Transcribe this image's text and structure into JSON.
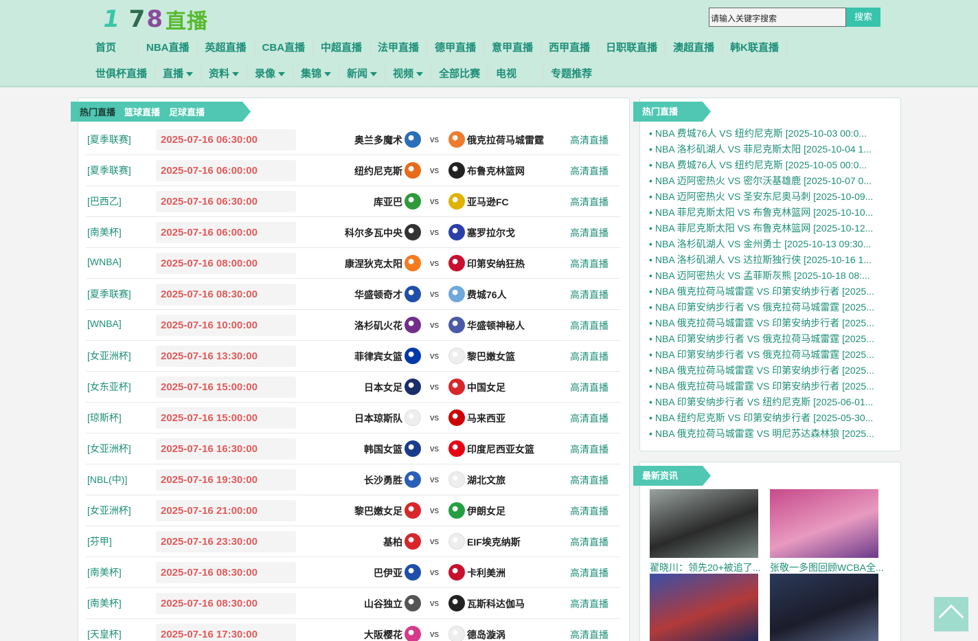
{
  "logo": {
    "p1": "1",
    "p2": "7",
    "p3": "8",
    "p4": "直播"
  },
  "search": {
    "placeholder": "请输入关键字搜索",
    "button": "搜索"
  },
  "nav_row1": [
    "首页",
    "NBA直播",
    "英超直播",
    "CBA直播",
    "中超直播",
    "法甲直播",
    "德甲直播",
    "意甲直播",
    "西甲直播",
    "日职联直播",
    "澳超直播",
    "韩K联直播"
  ],
  "nav_row2": [
    {
      "label": "世俱杯直播",
      "dropdown": false
    },
    {
      "label": "直播",
      "dropdown": true
    },
    {
      "label": "资料",
      "dropdown": true
    },
    {
      "label": "录像",
      "dropdown": true
    },
    {
      "label": "集锦",
      "dropdown": true
    },
    {
      "label": "新闻",
      "dropdown": true
    },
    {
      "label": "视频",
      "dropdown": true
    },
    {
      "label": "全部比赛",
      "dropdown": false
    },
    {
      "label": "电视",
      "dropdown": false
    },
    {
      "label": "专题推荐",
      "dropdown": false
    }
  ],
  "tabs": [
    "热门直播",
    "篮球直播",
    "足球直播"
  ],
  "matches": [
    {
      "league": "[夏季联赛]",
      "time": "2025-07-16 06:30:00",
      "home": "奥兰多魔术",
      "away": "俄克拉荷马城雷霆",
      "home_color": "#2a6fb8",
      "away_color": "#ef7c2e",
      "link": "高清直播"
    },
    {
      "league": "[夏季联赛]",
      "time": "2025-07-16 06:00:00",
      "home": "纽约尼克斯",
      "away": "布鲁克林篮网",
      "home_color": "#e86b1a",
      "away_color": "#222222",
      "link": "高清直播"
    },
    {
      "league": "[巴西乙]",
      "time": "2025-07-16 06:30:00",
      "home": "库亚巴",
      "away": "亚马逊FC",
      "home_color": "#2e9a3a",
      "away_color": "#e0b300",
      "link": "高清直播"
    },
    {
      "league": "[南美杯]",
      "time": "2025-07-16 06:00:00",
      "home": "科尔多瓦中央",
      "away": "塞罗拉尔戈",
      "home_color": "#333333",
      "away_color": "#2a3fa8",
      "link": "高清直播"
    },
    {
      "league": "[WNBA]",
      "time": "2025-07-16 08:00:00",
      "home": "康涅狄克太阳",
      "away": "印第安纳狂热",
      "home_color": "#f47b20",
      "away_color": "#c8102e",
      "link": "高清直播"
    },
    {
      "league": "[夏季联赛]",
      "time": "2025-07-16 08:30:00",
      "home": "华盛顿奇才",
      "away": "费城76人",
      "home_color": "#1f4fa8",
      "away_color": "#6fa8dc",
      "link": "高清直播"
    },
    {
      "league": "[WNBA]",
      "time": "2025-07-16 10:00:00",
      "home": "洛杉矶火花",
      "away": "华盛顿神秘人",
      "home_color": "#702f8a",
      "away_color": "#4a5aa8",
      "link": "高清直播"
    },
    {
      "league": "[女亚洲杯]",
      "time": "2025-07-16 13:30:00",
      "home": "菲律宾女篮",
      "away": "黎巴嫩女篮",
      "home_color": "#0038a8",
      "away_color": "#eeeeee",
      "link": "高清直播"
    },
    {
      "league": "[女东亚杯]",
      "time": "2025-07-16 15:00:00",
      "home": "日本女足",
      "away": "中国女足",
      "home_color": "#1c2d6b",
      "away_color": "#d9262b",
      "link": "高清直播"
    },
    {
      "league": "[琼斯杯]",
      "time": "2025-07-16 15:00:00",
      "home": "日本琼斯队",
      "away": "马来西亚",
      "home_color": "#eeeeee",
      "away_color": "#cc0001",
      "link": "高清直播"
    },
    {
      "league": "[女亚洲杯]",
      "time": "2025-07-16 16:30:00",
      "home": "韩国女篮",
      "away": "印度尼西亚女篮",
      "home_color": "#1a3c8c",
      "away_color": "#e60012",
      "link": "高清直播"
    },
    {
      "league": "[NBL(中)]",
      "time": "2025-07-16 19:30:00",
      "home": "长沙勇胜",
      "away": "湖北文旅",
      "home_color": "#2a5fb8",
      "away_color": "#eeeeee",
      "link": "高清直播"
    },
    {
      "league": "[女亚洲杯]",
      "time": "2025-07-16 21:00:00",
      "home": "黎巴嫩女足",
      "away": "伊朗女足",
      "home_color": "#d9262b",
      "away_color": "#239f40",
      "link": "高清直播"
    },
    {
      "league": "[芬甲]",
      "time": "2025-07-16 23:30:00",
      "home": "基柏",
      "away": "EIF埃克纳斯",
      "home_color": "#d9262b",
      "away_color": "#eeeeee",
      "link": "高清直播"
    },
    {
      "league": "[南美杯]",
      "time": "2025-07-16 08:30:00",
      "home": "巴伊亚",
      "away": "卡利美洲",
      "home_color": "#1f4fa8",
      "away_color": "#c8102e",
      "link": "高清直播"
    },
    {
      "league": "[南美杯]",
      "time": "2025-07-16 08:30:00",
      "home": "山谷独立",
      "away": "瓦斯科达伽马",
      "home_color": "#555555",
      "away_color": "#222222",
      "link": "高清直播"
    },
    {
      "league": "[天皇杯]",
      "time": "2025-07-16 17:30:00",
      "home": "大阪樱花",
      "away": "德岛漩涡",
      "home_color": "#d63a8a",
      "away_color": "#eeeeee",
      "link": "高清直播"
    }
  ],
  "hot_title": "热门直播",
  "hot_list": [
    "NBA 费城76人 VS 纽约尼克斯 [2025-10-03 00:0...",
    "NBA 洛杉矶湖人 VS 菲尼克斯太阳 [2025-10-04 1...",
    "NBA 费城76人 VS 纽约尼克斯 [2025-10-05 00:0...",
    "NBA 迈阿密热火 VS 密尔沃基雄鹿 [2025-10-07 0...",
    "NBA 迈阿密热火 VS 圣安东尼奥马刺 [2025-10-09...",
    "NBA 菲尼克斯太阳 VS 布鲁克林篮网 [2025-10-10...",
    "NBA 菲尼克斯太阳 VS 布鲁克林篮网 [2025-10-12...",
    "NBA 洛杉矶湖人 VS 金州勇士 [2025-10-13 09:30...",
    "NBA 洛杉矶湖人 VS 达拉斯独行侠 [2025-10-16 1...",
    "NBA 迈阿密热火 VS 孟菲斯灰熊 [2025-10-18 08:...",
    "NBA 俄克拉荷马城雷霆 VS 印第安纳步行者 [2025...",
    "NBA 印第安纳步行者 VS 俄克拉荷马城雷霆 [2025...",
    "NBA 俄克拉荷马城雷霆 VS 印第安纳步行者 [2025...",
    "NBA 印第安纳步行者 VS 俄克拉荷马城雷霆 [2025...",
    "NBA 印第安纳步行者 VS 俄克拉荷马城雷霆 [2025...",
    "NBA 俄克拉荷马城雷霆 VS 印第安纳步行者 [2025...",
    "NBA 俄克拉荷马城雷霆 VS 印第安纳步行者 [2025...",
    "NBA 印第安纳步行者 VS 纽约尼克斯 [2025-06-01...",
    "NBA 纽约尼克斯 VS 印第安纳步行者 [2025-05-30...",
    "NBA 俄克拉荷马城雷霆 VS 明尼苏达森林狼 [2025..."
  ],
  "news_title": "最新资讯",
  "news": [
    {
      "caption": "翟晓川：领先20+被追了...",
      "colors": [
        "#9aa3a0",
        "#2a2a2a",
        "#7a8a84"
      ]
    },
    {
      "caption": "张敬一多图回顾WCBA全...",
      "colors": [
        "#c64a8a",
        "#e89ac0",
        "#6a3a8a"
      ]
    },
    {
      "caption": "",
      "colors": [
        "#3a4fa8",
        "#b23a3a",
        "#1c2a5a"
      ]
    },
    {
      "caption": "",
      "colors": [
        "#2a3a5a",
        "#1c1c2a",
        "#5a6a8a"
      ]
    }
  ]
}
